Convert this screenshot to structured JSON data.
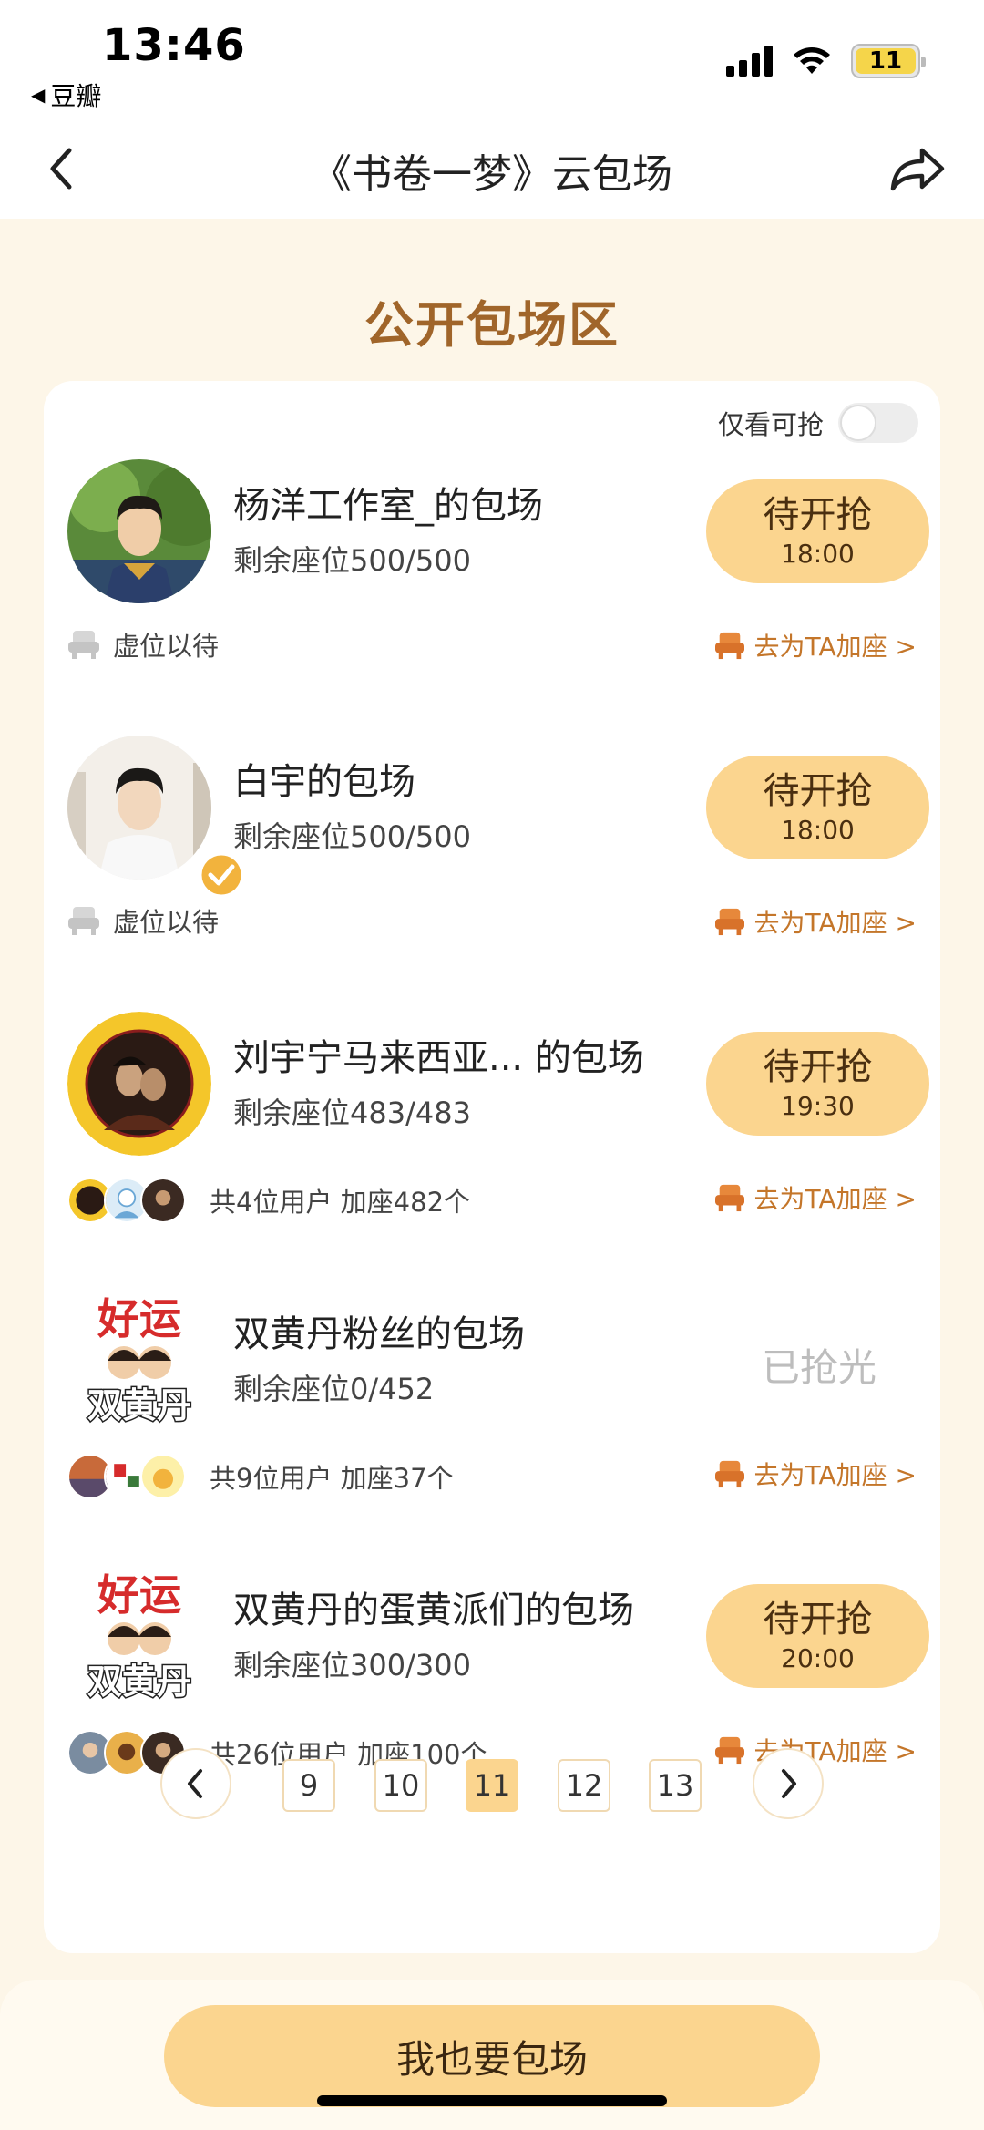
{
  "status": {
    "time": "13:46",
    "back_app": "豆瓣",
    "battery": "11"
  },
  "nav": {
    "title": "《书卷一梦》云包场"
  },
  "section_title": "公开包场区",
  "filter": {
    "label": "仅看可抢",
    "enabled": false
  },
  "items": [
    {
      "title": "杨洋工作室_的包场",
      "seats": "剩余座位500/500",
      "button_main": "待开抢",
      "button_time": "18:00",
      "foot_left": "虚位以待",
      "foot_right": "去为TA加座 >"
    },
    {
      "title": "白宇的包场",
      "seats": "剩余座位500/500",
      "button_main": "待开抢",
      "button_time": "18:00",
      "foot_left": "虚位以待",
      "foot_right": "去为TA加座 >"
    },
    {
      "title": "刘宇宁马来西亚... 的包场",
      "seats": "剩余座位483/483",
      "button_main": "待开抢",
      "button_time": "19:30",
      "foot_left": "共4位用户 加座482个",
      "foot_right": "去为TA加座 >"
    },
    {
      "title": "双黄丹粉丝的包场",
      "seats": "剩余座位0/452",
      "button_main": "已抢光",
      "foot_left": "共9位用户 加座37个",
      "foot_right": "去为TA加座 >"
    },
    {
      "title": "双黄丹的蛋黄派们的包场",
      "seats": "剩余座位300/300",
      "button_main": "待开抢",
      "button_time": "20:00",
      "foot_left": "共26位用户 加座100个",
      "foot_right": "去为TA加座 >"
    }
  ],
  "avatar_text": {
    "logo_top": "好运",
    "logo_bottom": "双黄丹"
  },
  "pager": {
    "pages": [
      "9",
      "10",
      "11",
      "12",
      "13"
    ],
    "current": "11"
  },
  "bottom_button": "我也要包场",
  "colors": {
    "accent": "#fbd58f",
    "title_brown": "#a0652a",
    "link_orange": "#c4762a",
    "background": "#fdf6e8"
  }
}
